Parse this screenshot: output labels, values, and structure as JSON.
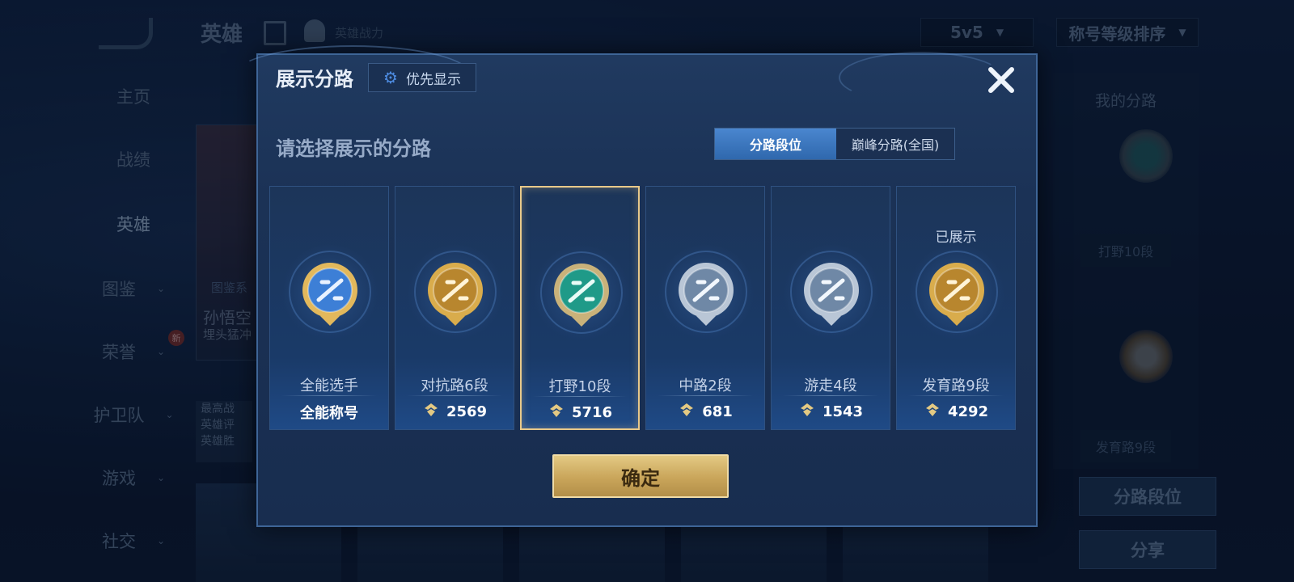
{
  "background": {
    "header": {
      "title": "英雄",
      "subtitle": "英雄战力",
      "mode_select": "5v5",
      "sort_select": "称号等级排序"
    },
    "nav_items": [
      {
        "label": "主页"
      },
      {
        "label": "战绩"
      },
      {
        "label": "英雄"
      },
      {
        "label": "图鉴"
      },
      {
        "label": "荣誉"
      },
      {
        "label": "护卫队"
      },
      {
        "label": "游戏"
      },
      {
        "label": "社交"
      }
    ],
    "new_badge": "新",
    "hero_card": {
      "tag": "图鉴系",
      "name": "孙悟空",
      "desc": "埋头猛冲"
    },
    "hero_info": [
      "最高战",
      "英雄评",
      "英雄胜"
    ],
    "right_panel": {
      "title": "我的分路",
      "label_1": "打野10段",
      "label_2": "发育路9段",
      "button_1": "分路段位",
      "button_2": "分享"
    }
  },
  "modal": {
    "title": "展示分路",
    "priority_label": "优先显示",
    "subtitle": "请选择展示的分路",
    "tabs": [
      {
        "label": "分路段位",
        "active": true
      },
      {
        "label": "巅峰分路(全国)",
        "active": false
      }
    ],
    "cards": [
      {
        "name": "全能选手",
        "value": "全能称号",
        "show_fist": false,
        "emblem": "blue-gold",
        "selected": false,
        "shown_label": ""
      },
      {
        "name": "对抗路6段",
        "value": "2569",
        "show_fist": true,
        "emblem": "gold",
        "selected": false,
        "shown_label": ""
      },
      {
        "name": "打野10段",
        "value": "5716",
        "show_fist": true,
        "emblem": "green",
        "selected": true,
        "shown_label": ""
      },
      {
        "name": "中路2段",
        "value": "681",
        "show_fist": true,
        "emblem": "silver",
        "selected": false,
        "shown_label": ""
      },
      {
        "name": "游走4段",
        "value": "1543",
        "show_fist": true,
        "emblem": "silver",
        "selected": false,
        "shown_label": ""
      },
      {
        "name": "发育路9段",
        "value": "4292",
        "show_fist": true,
        "emblem": "gold",
        "selected": false,
        "shown_label": "已展示"
      }
    ],
    "confirm_label": "确定"
  },
  "colors": {
    "accent_gold": "#e3c983",
    "accent_blue": "#4a86cf",
    "emblem_green": "#1f9a88",
    "emblem_silver": "#b9c6d6",
    "emblem_gold": "#d9ac4c"
  }
}
